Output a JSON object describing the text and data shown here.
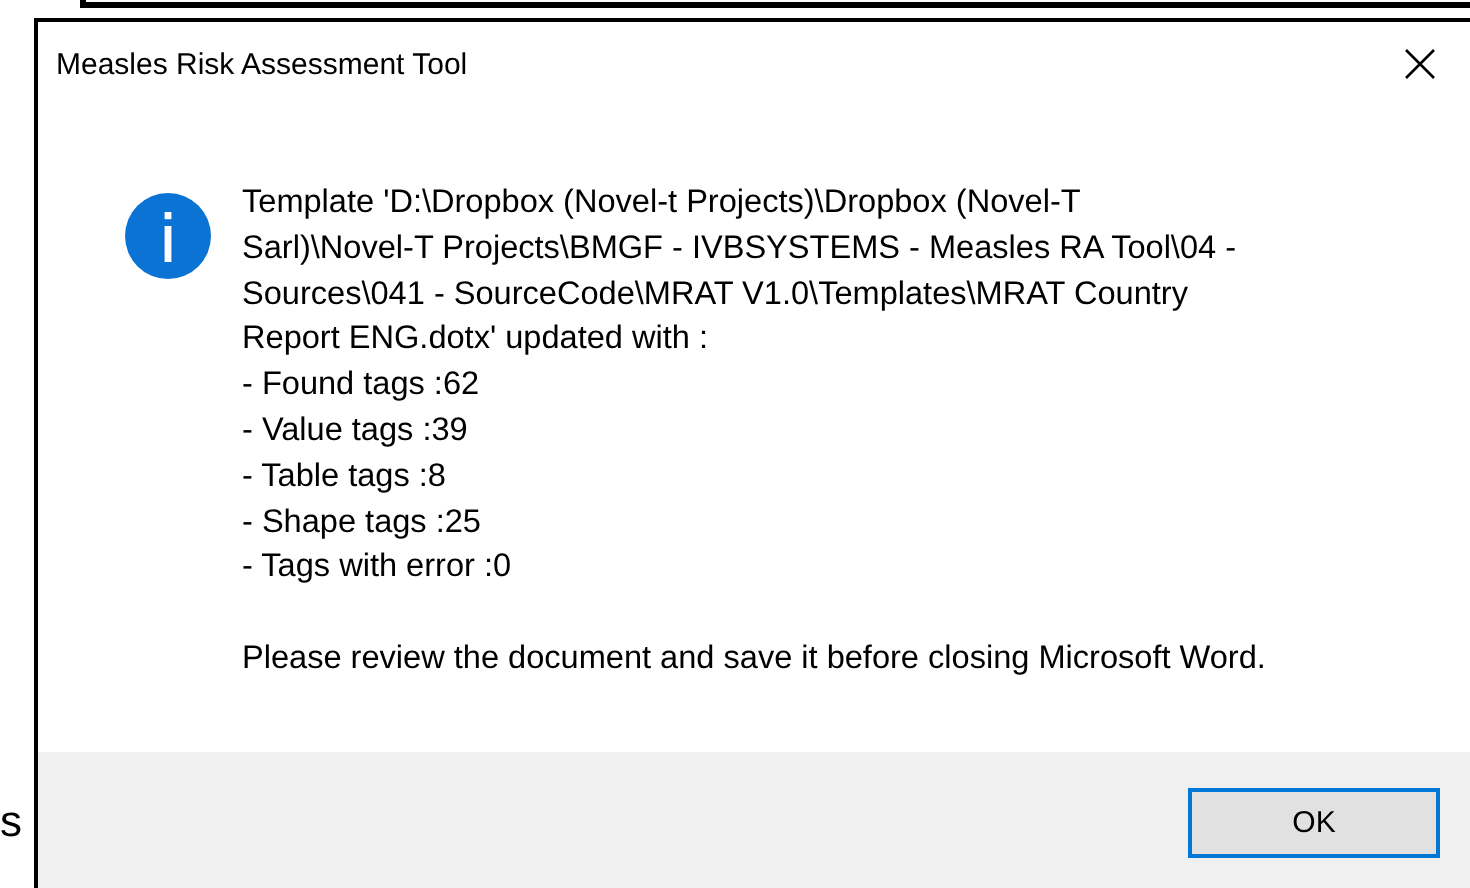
{
  "background": {
    "text": "s"
  },
  "window": {
    "title": "Measles Risk Assessment Tool"
  },
  "message": {
    "lines": [
      "Template 'D:\\Dropbox (Novel-t Projects)\\Dropbox (Novel-T",
      "Sarl)\\Novel-T Projects\\BMGF - IVBSYSTEMS - Measles RA Tool\\04 -",
      "Sources\\041 - SourceCode\\MRAT V1.0\\Templates\\MRAT Country",
      "Report ENG.dotx' updated with :",
      "- Found tags :62",
      "- Value tags :39",
      "- Table tags :8",
      "- Shape tags :25",
      "- Tags with error :0"
    ],
    "note": "Please review the document and save it before closing Microsoft Word."
  },
  "buttons": [
    {
      "label": "OK",
      "selected": true
    }
  ]
}
